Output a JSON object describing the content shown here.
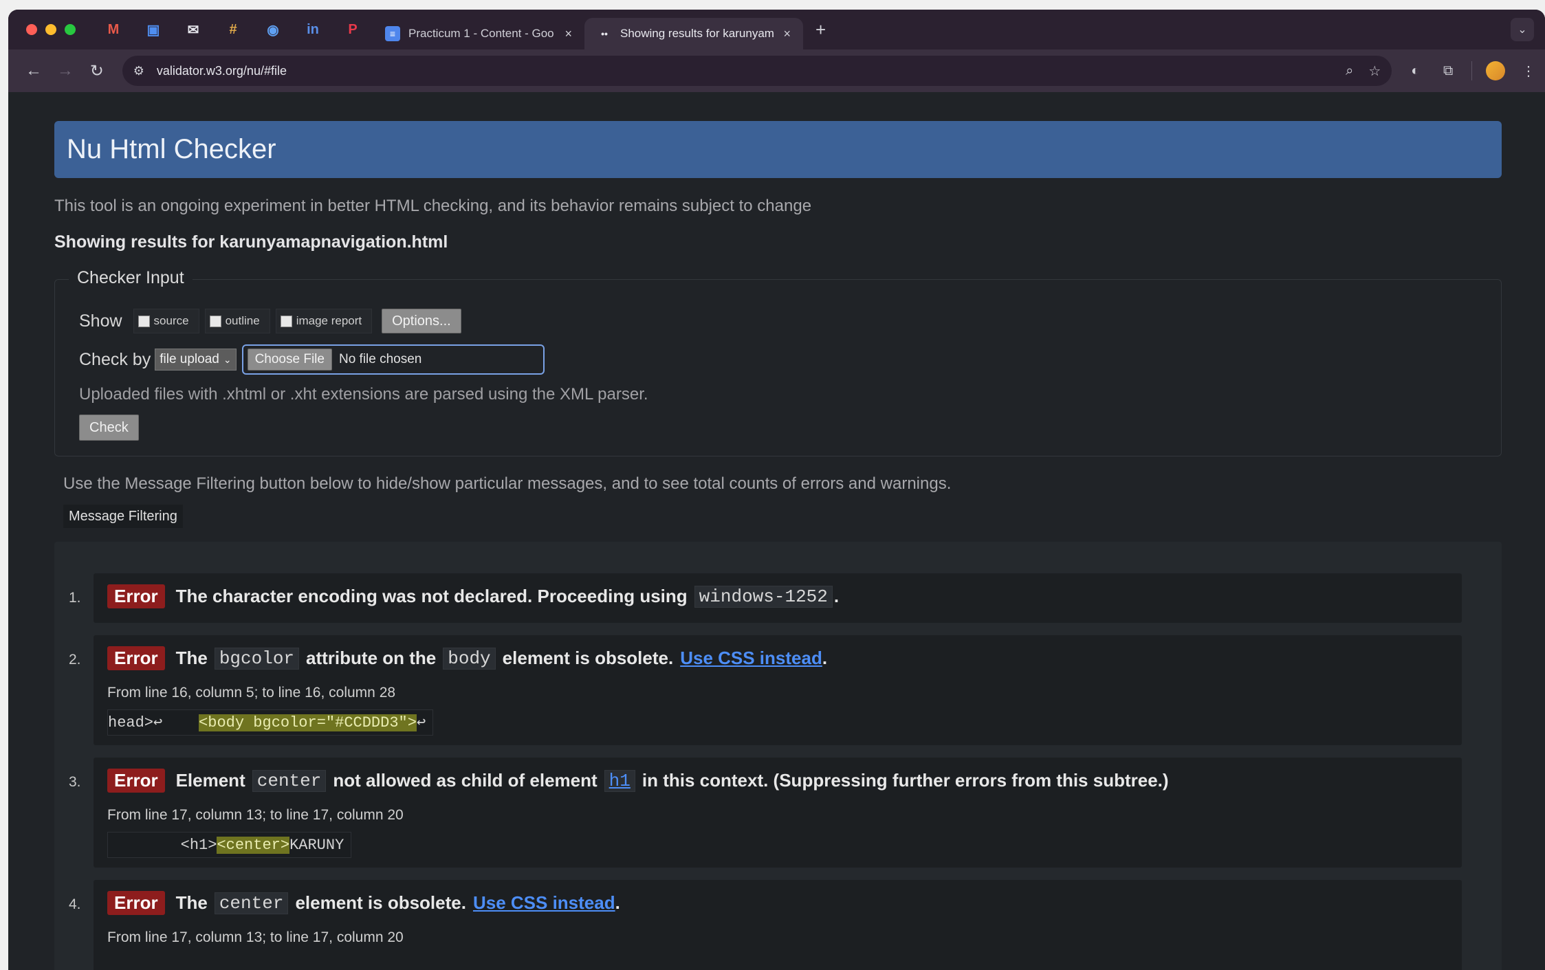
{
  "browser": {
    "pinned_tabs": [
      {
        "icon": "gmail-icon",
        "glyph": "M"
      },
      {
        "icon": "google-meet-icon",
        "glyph": "▣"
      },
      {
        "icon": "mail-icon",
        "glyph": "✉"
      },
      {
        "icon": "slack-icon",
        "glyph": "#"
      },
      {
        "icon": "chrome-icon",
        "glyph": "◉"
      },
      {
        "icon": "linkedin-icon",
        "glyph": "in"
      },
      {
        "icon": "pinterest-icon",
        "glyph": "P"
      }
    ],
    "tabs": [
      {
        "title": "Practicum 1 - Content - Goo",
        "close": "×",
        "active": false,
        "icon_glyph": "≡"
      },
      {
        "title": "Showing results for karunyam",
        "close": "×",
        "active": true,
        "icon_glyph": "••"
      }
    ],
    "new_tab": "+",
    "url": "validator.w3.org/nu/#file"
  },
  "page": {
    "title": "Nu Html Checker",
    "intro": "This tool is an ongoing experiment in better HTML checking, and its behavior remains subject to change",
    "results_for": "Showing results for karunyamapnavigation.html",
    "checker_input": {
      "legend": "Checker Input",
      "show_label": "Show",
      "show_options": [
        "source",
        "outline",
        "image report"
      ],
      "options_button": "Options...",
      "check_by_label": "Check by",
      "check_by_value": "file upload",
      "choose_file_button": "Choose File",
      "file_status": "No file chosen",
      "upload_note": "Uploaded files with .xhtml or .xht extensions are parsed using the XML parser.",
      "check_button": "Check"
    },
    "filter_note": "Use the Message Filtering button below to hide/show particular messages, and to see total counts of errors and warnings.",
    "filter_button": "Message Filtering",
    "messages": [
      {
        "num": "1.",
        "type": "Error",
        "t1": "The character encoding was not declared. Proceeding using",
        "c1": "windows-1252",
        "t2": "."
      },
      {
        "num": "2.",
        "type": "Error",
        "t1": "The",
        "c1": "bgcolor",
        "t2": "attribute on the",
        "c2": "body",
        "t3": "element is obsolete.",
        "link": "Use CSS instead",
        "t4": ".",
        "loc": "From line 16, column 5; to line 16, column 28",
        "ex_pre": "head>↩    ",
        "ex_hl": "<body bgcolor=\"#CCDDD3\">",
        "ex_post": "↩"
      },
      {
        "num": "3.",
        "type": "Error",
        "t1": "Element",
        "c1": "center",
        "t2": "not allowed as child of element",
        "c2": "h1",
        "t3": "in this context. (Suppressing further errors from this subtree.)",
        "loc": "From line 17, column 13; to line 17, column 20",
        "ex_pre": "        <h1>",
        "ex_hl": "<center>",
        "ex_post": "KARUNY"
      },
      {
        "num": "4.",
        "type": "Error",
        "t1": "The",
        "c1": "center",
        "t2": "element is obsolete.",
        "link": "Use CSS instead",
        "t3": ".",
        "loc": "From line 17, column 13; to line 17, column 20"
      }
    ]
  },
  "colors": {
    "header_bg": "#3c6196",
    "error_badge": "#8d1d1d",
    "link": "#4d8ef7",
    "highlight": "#6f7420"
  }
}
